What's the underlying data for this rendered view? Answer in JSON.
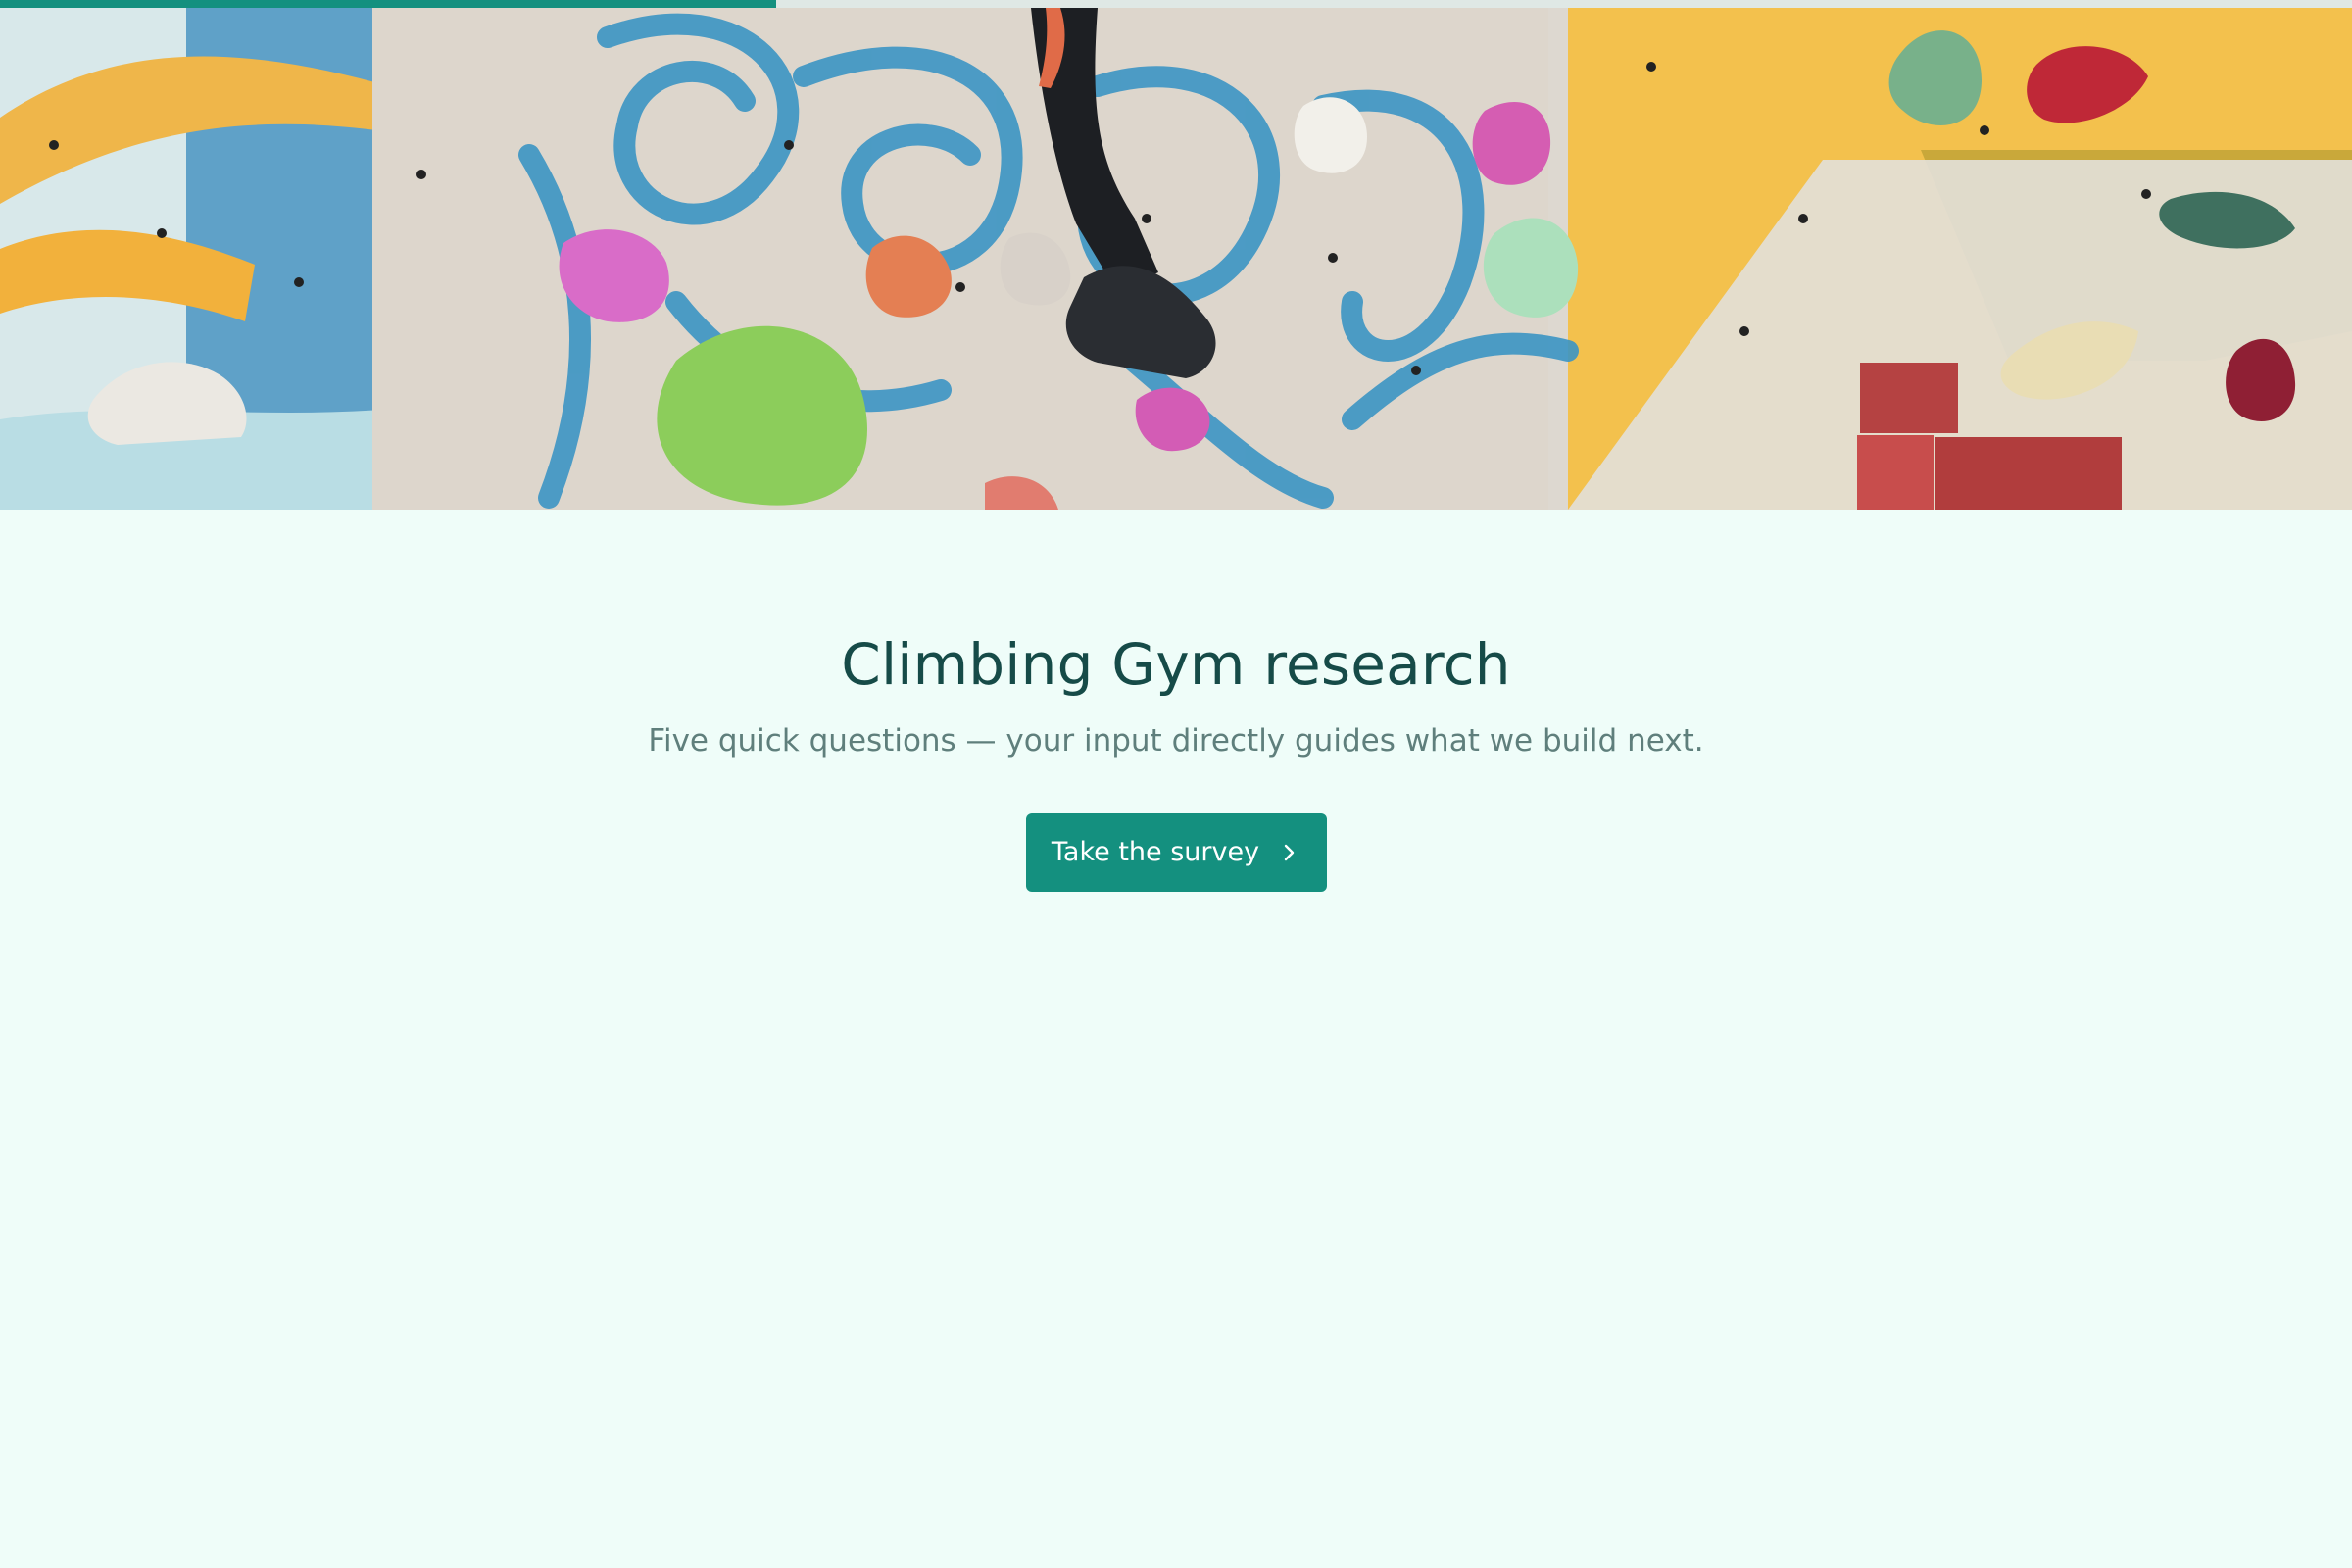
{
  "survey": {
    "title": "Climbing Gym research",
    "subtitle": "Five quick questions — your input directly guides what we build next.",
    "cta_label": "Take the survey",
    "cta_icon": "chevron-right-icon"
  },
  "progress": {
    "value": 0.33
  },
  "hero": {
    "image_description": "Colorful climbing wall with climber's legs and holds"
  },
  "colors": {
    "accent": "#14907f",
    "background": "#effdf9",
    "title": "#164b48",
    "subtitle": "#5f7f7c",
    "progress_track": "#dfe8e5"
  }
}
